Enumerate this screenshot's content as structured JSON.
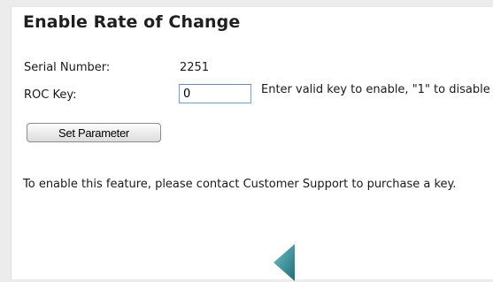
{
  "page": {
    "title": "Enable Rate of Change"
  },
  "form": {
    "serial_label": "Serial Number:",
    "serial_value": "2251",
    "roc_label": "ROC Key:",
    "roc_value": "0",
    "roc_hint": "Enter valid key to enable, \"1\" to disable",
    "set_button_label": "Set Parameter"
  },
  "notice": {
    "text": "To enable this feature, please contact Customer Support to purchase a key."
  },
  "navigation": {
    "back_icon": "triangle-left-icon",
    "accent_color": "#3a8a93"
  }
}
